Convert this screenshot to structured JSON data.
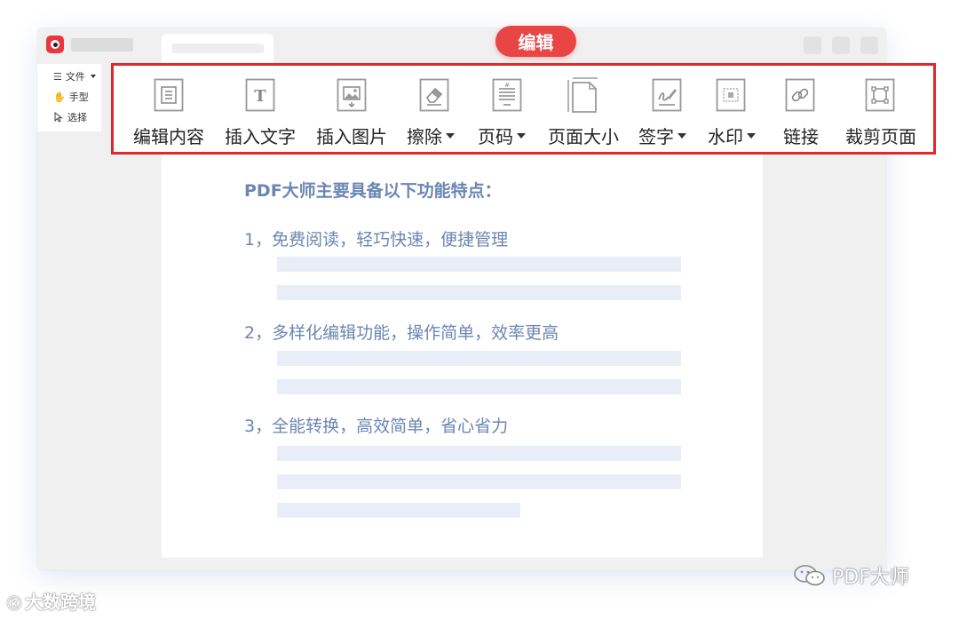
{
  "window": {
    "edit_badge": "编辑"
  },
  "left_panel": {
    "file_menu": "文件",
    "hand_tool": "手型",
    "select_tool": "选择"
  },
  "toolbar": {
    "items": [
      {
        "label": "编辑内容",
        "icon": "edit-content-icon",
        "dropdown": false
      },
      {
        "label": "插入文字",
        "icon": "insert-text-icon",
        "dropdown": false
      },
      {
        "label": "插入图片",
        "icon": "insert-image-icon",
        "dropdown": false
      },
      {
        "label": "擦除",
        "icon": "eraser-icon",
        "dropdown": true
      },
      {
        "label": "页码",
        "icon": "page-number-icon",
        "dropdown": true
      },
      {
        "label": "页面大小",
        "icon": "page-size-icon",
        "dropdown": false
      },
      {
        "label": "签字",
        "icon": "signature-icon",
        "dropdown": true
      },
      {
        "label": "水印",
        "icon": "watermark-icon",
        "dropdown": true
      },
      {
        "label": "链接",
        "icon": "link-icon",
        "dropdown": false
      },
      {
        "label": "裁剪页面",
        "icon": "crop-page-icon",
        "dropdown": false
      }
    ],
    "highlight_color": "#e0292b"
  },
  "document": {
    "heading": "PDF大师主要具备以下功能特点：",
    "items": [
      "1，免费阅读，轻巧快速，便捷管理",
      "2，多样化编辑功能，操作简单，效率更高",
      "3，全能转换，高效简单，省心省力"
    ],
    "text_color": "#6c86b2"
  },
  "watermarks": {
    "left": "大数跨境",
    "right": "PDF大师"
  }
}
